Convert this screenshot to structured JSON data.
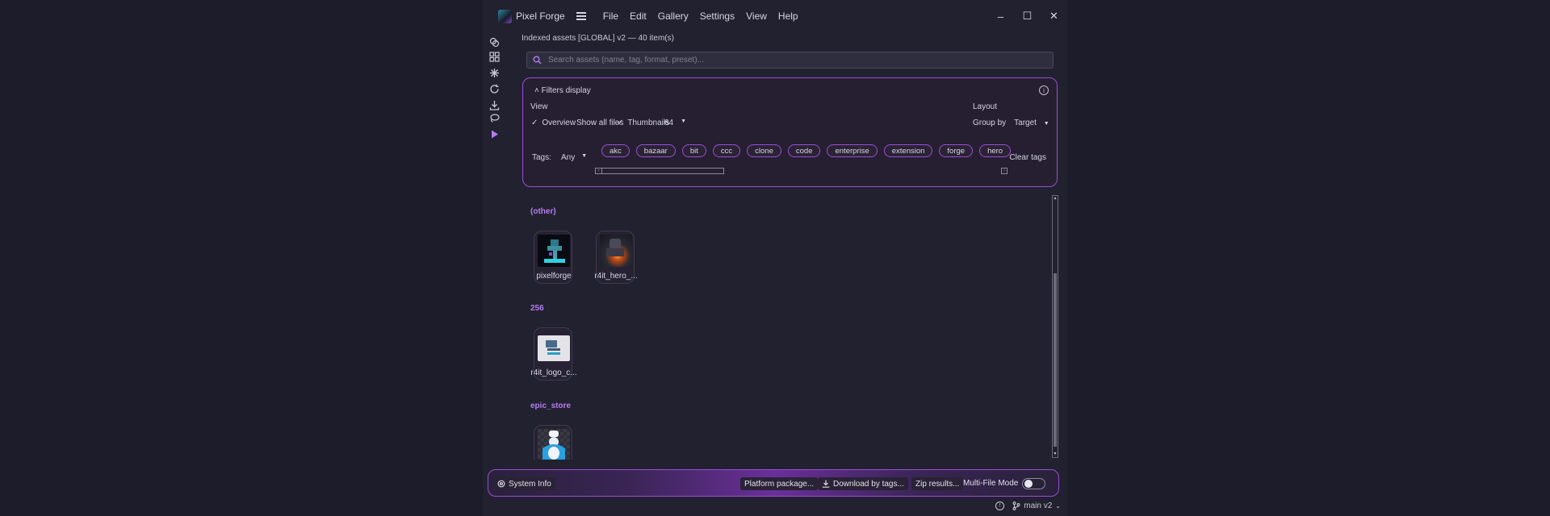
{
  "app": {
    "title": "Pixel Forge"
  },
  "menu": [
    "File",
    "Edit",
    "Gallery",
    "Settings",
    "View",
    "Help"
  ],
  "window_controls": {
    "minimize": "–",
    "maximize": "☐",
    "close": "✕"
  },
  "status_top": "Indexed assets [GLOBAL] v2 — 40 item(s)",
  "search": {
    "placeholder": "Search assets (name, tag, format, preset)...",
    "value": ""
  },
  "filters": {
    "toggle_label": "Filters display",
    "view_label": "View",
    "layout_label": "Layout",
    "overview": {
      "label": "Overview",
      "checked": true
    },
    "show_all_files": {
      "label": "Show all files",
      "checked": false
    },
    "thumbnails": {
      "label": "Thumbnails",
      "checked": true,
      "size": "64"
    },
    "group_by": {
      "label": "Group by",
      "value": "Target"
    },
    "tags_label": "Tags:",
    "tags_mode": "Any",
    "tags": [
      "akc",
      "bazaar",
      "bit",
      "ccc",
      "clone",
      "code",
      "enterprise",
      "extension",
      "forge",
      "hero"
    ],
    "clear_tags": "Clear tags"
  },
  "groups": [
    {
      "name": "(other)",
      "items": [
        "pixelforge",
        "r4it_hero_..."
      ]
    },
    {
      "name": "256",
      "items": [
        "r4it_logo_c..."
      ]
    },
    {
      "name": "epic_store",
      "items": [
        ""
      ]
    }
  ],
  "bottom": {
    "system_info": "System Info",
    "platform_package": "Platform package...",
    "download_by_tags": "Download by tags...",
    "zip_results": "Zip results...",
    "multi_file_mode": "Multi-File Mode",
    "multi_file_mode_on": false
  },
  "footer": {
    "branch": "main v2"
  },
  "colors": {
    "accent": "#9a4ed6",
    "group_label": "#b67cf0",
    "background": "#21212f"
  }
}
